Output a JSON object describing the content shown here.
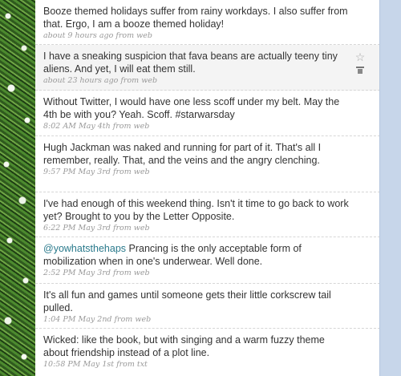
{
  "tweets": [
    {
      "text": "Booze themed holidays suffer from rainy workdays. I also suffer from that. Ergo, I am a booze themed holiday!",
      "meta": "about 9 hours ago from web"
    },
    {
      "text": "I have a sneaking suspicion that fava beans are actually teeny tiny aliens. And yet, I will eat them still.",
      "meta": "about 23 hours ago from web",
      "star_icon": "star-outline",
      "delete_icon": "trash"
    },
    {
      "text": "Without Twitter, I would have one less scoff under my belt. May the 4th be with you? Yeah. Scoff. #starwarsday",
      "meta": "8:02 AM May 4th from web"
    },
    {
      "text": "Hugh Jackman was naked and running for part of it. That's all I remember, really. That, and the veins and the angry clenching.",
      "meta": "9:57 PM May 3rd from web"
    },
    {
      "text": "I've had enough of this weekend thing. Isn't it time to go back to work yet? Brought to you by the Letter Opposite.",
      "meta": "6:22 PM May 3rd from web"
    },
    {
      "mention": "@yowhatsthehaps",
      "text": " Prancing is the only acceptable form of mobilization when in one's underwear. Well done.",
      "meta": "2:52 PM May 3rd from web"
    },
    {
      "text": "It's all fun and games until someone gets their little corkscrew tail pulled.",
      "meta": "1:04 PM May 2nd from web"
    },
    {
      "text": "Wicked: like the book, but with singing and a warm fuzzy theme about friendship instead of a plot line.",
      "meta": "10:58 PM May 1st from txt"
    }
  ],
  "colors": {
    "mention": "#2a7a8c",
    "meta": "#999999",
    "sidebar": "#c7d6ea",
    "hover_row": "#f4f4f4"
  }
}
